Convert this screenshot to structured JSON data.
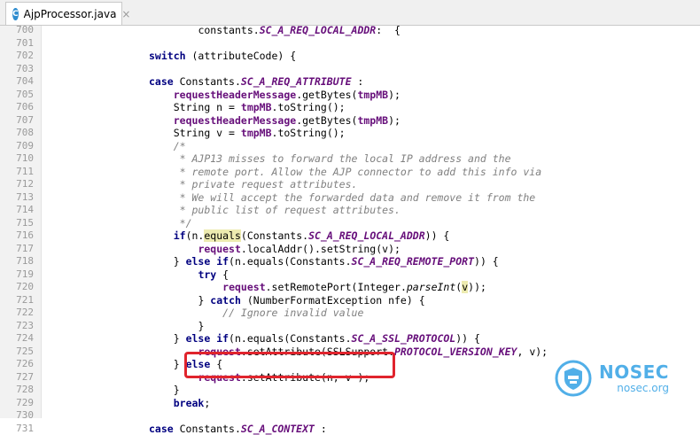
{
  "tab": {
    "icon": "java-class-icon",
    "icon_letter": "C",
    "title": "AjpProcessor.java",
    "close": "×"
  },
  "lines": [
    {
      "n": "700",
      "indent": 8,
      "segs": [
        {
          "t": "constants."
        },
        {
          "t": "SC_A_REQ_LOCAL_ADDR",
          "c": "cst"
        },
        {
          "t": ":  {"
        }
      ]
    },
    {
      "n": "701",
      "indent": 0,
      "segs": []
    },
    {
      "n": "702",
      "indent": 0,
      "segs": [
        {
          "t": "switch",
          "c": "kw"
        },
        {
          "t": " (attributeCode) {"
        }
      ]
    },
    {
      "n": "703",
      "indent": 0,
      "segs": []
    },
    {
      "n": "704",
      "indent": 0,
      "segs": [
        {
          "t": "case",
          "c": "kw"
        },
        {
          "t": " Constants."
        },
        {
          "t": "SC_A_REQ_ATTRIBUTE",
          "c": "cst"
        },
        {
          "t": " :"
        }
      ]
    },
    {
      "n": "705",
      "indent": 4,
      "segs": [
        {
          "t": "requestHeaderMessage",
          "c": "fld"
        },
        {
          "t": ".getBytes("
        },
        {
          "t": "tmpMB",
          "c": "fld"
        },
        {
          "t": ");"
        }
      ]
    },
    {
      "n": "706",
      "indent": 4,
      "segs": [
        {
          "t": "String n = "
        },
        {
          "t": "tmpMB",
          "c": "fld"
        },
        {
          "t": ".toString();"
        }
      ]
    },
    {
      "n": "707",
      "indent": 4,
      "segs": [
        {
          "t": "requestHeaderMessage",
          "c": "fld"
        },
        {
          "t": ".getBytes("
        },
        {
          "t": "tmpMB",
          "c": "fld"
        },
        {
          "t": ");"
        }
      ]
    },
    {
      "n": "708",
      "indent": 4,
      "segs": [
        {
          "t": "String v = "
        },
        {
          "t": "tmpMB",
          "c": "fld"
        },
        {
          "t": ".toString();"
        }
      ]
    },
    {
      "n": "709",
      "indent": 4,
      "segs": [
        {
          "t": "/*",
          "c": "cm"
        }
      ]
    },
    {
      "n": "710",
      "indent": 4,
      "segs": [
        {
          "t": " * AJP13 misses to forward the local IP address and the",
          "c": "cm"
        }
      ]
    },
    {
      "n": "711",
      "indent": 4,
      "segs": [
        {
          "t": " * remote port. Allow the AJP connector to add this info via",
          "c": "cm"
        }
      ]
    },
    {
      "n": "712",
      "indent": 4,
      "segs": [
        {
          "t": " * private request attributes.",
          "c": "cm"
        }
      ]
    },
    {
      "n": "713",
      "indent": 4,
      "segs": [
        {
          "t": " * We will accept the forwarded data and remove it from the",
          "c": "cm"
        }
      ]
    },
    {
      "n": "714",
      "indent": 4,
      "segs": [
        {
          "t": " * public list of request attributes.",
          "c": "cm"
        }
      ]
    },
    {
      "n": "715",
      "indent": 4,
      "segs": [
        {
          "t": " */",
          "c": "cm"
        }
      ]
    },
    {
      "n": "716",
      "indent": 4,
      "segs": [
        {
          "t": "if",
          "c": "kw"
        },
        {
          "t": "(n."
        },
        {
          "t": "equals",
          "c": "hl"
        },
        {
          "t": "(Constants."
        },
        {
          "t": "SC_A_REQ_LOCAL_ADDR",
          "c": "cst"
        },
        {
          "t": ")) {"
        }
      ]
    },
    {
      "n": "717",
      "indent": 8,
      "segs": [
        {
          "t": "request",
          "c": "fld"
        },
        {
          "t": ".localAddr().setString(v);"
        }
      ]
    },
    {
      "n": "718",
      "indent": 4,
      "segs": [
        {
          "t": "} "
        },
        {
          "t": "else if",
          "c": "kw"
        },
        {
          "t": "(n.equals(Constants."
        },
        {
          "t": "SC_A_REQ_REMOTE_PORT",
          "c": "cst"
        },
        {
          "t": ")) {"
        }
      ]
    },
    {
      "n": "719",
      "indent": 8,
      "segs": [
        {
          "t": "try",
          "c": "kw"
        },
        {
          "t": " {"
        }
      ]
    },
    {
      "n": "720",
      "indent": 12,
      "segs": [
        {
          "t": "request",
          "c": "fld"
        },
        {
          "t": ".setRemotePort(Integer."
        },
        {
          "t": "parseInt",
          "c": "sm"
        },
        {
          "t": "("
        },
        {
          "t": "v",
          "c": "hl"
        },
        {
          "t": "));"
        }
      ]
    },
    {
      "n": "721",
      "indent": 8,
      "segs": [
        {
          "t": "} "
        },
        {
          "t": "catch",
          "c": "kw"
        },
        {
          "t": " (NumberFormatException nfe) {"
        }
      ]
    },
    {
      "n": "722",
      "indent": 12,
      "segs": [
        {
          "t": "// Ignore invalid value",
          "c": "cm"
        }
      ]
    },
    {
      "n": "723",
      "indent": 8,
      "segs": [
        {
          "t": "}"
        }
      ]
    },
    {
      "n": "724",
      "indent": 4,
      "segs": [
        {
          "t": "} "
        },
        {
          "t": "else if",
          "c": "kw"
        },
        {
          "t": "(n.equals(Constants."
        },
        {
          "t": "SC_A_SSL_PROTOCOL",
          "c": "cst"
        },
        {
          "t": ")) {"
        }
      ]
    },
    {
      "n": "725",
      "indent": 8,
      "segs": [
        {
          "t": "request",
          "c": "fld"
        },
        {
          "t": ".setAttribute(SSLSupport."
        },
        {
          "t": "PROTOCOL_VERSION_KEY",
          "c": "cst"
        },
        {
          "t": ", v);"
        }
      ]
    },
    {
      "n": "726",
      "indent": 4,
      "segs": [
        {
          "t": "} "
        },
        {
          "t": "else",
          "c": "kw"
        },
        {
          "t": " {"
        }
      ]
    },
    {
      "n": "727",
      "indent": 8,
      "segs": [
        {
          "t": "request",
          "c": "fld"
        },
        {
          "t": ".setAttribute(n, v );"
        }
      ]
    },
    {
      "n": "728",
      "indent": 4,
      "segs": [
        {
          "t": "}"
        }
      ]
    },
    {
      "n": "729",
      "indent": 4,
      "segs": [
        {
          "t": "break",
          "c": "kw"
        },
        {
          "t": ";"
        }
      ]
    },
    {
      "n": "730",
      "indent": 0,
      "segs": []
    },
    {
      "n": "731",
      "indent": 0,
      "segs": [
        {
          "t": "case",
          "c": "kw"
        },
        {
          "t": " Constants."
        },
        {
          "t": "SC_A_CONTEXT",
          "c": "cst"
        },
        {
          "t": " :"
        }
      ]
    }
  ],
  "highlighted_line": "727",
  "highlight_color": "#e0242d",
  "watermark": {
    "icon": "shield-logo-icon",
    "brand": "NOSEC",
    "domain": "nosec.org",
    "color": "#3fa7e6"
  }
}
